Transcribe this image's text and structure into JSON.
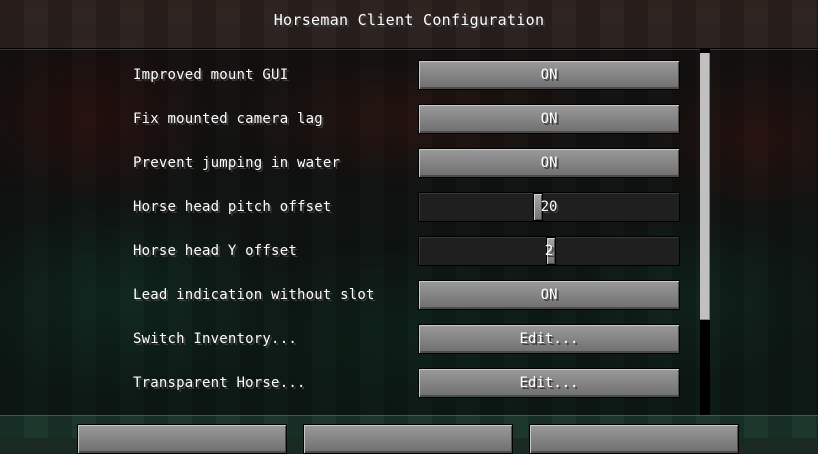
{
  "screen": {
    "title": "Horseman Client Configuration"
  },
  "options": [
    {
      "label": "Improved mount GUI",
      "type": "toggle",
      "value": "ON"
    },
    {
      "label": "Fix mounted camera lag",
      "type": "toggle",
      "value": "ON"
    },
    {
      "label": "Prevent jumping in water",
      "type": "toggle",
      "value": "ON"
    },
    {
      "label": "Horse head pitch offset",
      "type": "slider",
      "value": "20",
      "fraction": 0.45
    },
    {
      "label": "Horse head Y offset",
      "type": "slider",
      "value": "2",
      "fraction": 0.505
    },
    {
      "label": "Lead indication without slot",
      "type": "toggle",
      "value": "ON"
    },
    {
      "label": "Switch Inventory...",
      "type": "submenu",
      "value": "Edit..."
    },
    {
      "label": "Transparent Horse...",
      "type": "submenu",
      "value": "Edit..."
    }
  ],
  "scrollbar": {
    "thumb_fraction": 0.73
  },
  "footer": {
    "buttons": [
      "",
      "",
      ""
    ]
  },
  "colors": {
    "button_face": "#8a8a8a",
    "slider_track": "#1f1f1f",
    "text": "#ffffff"
  }
}
